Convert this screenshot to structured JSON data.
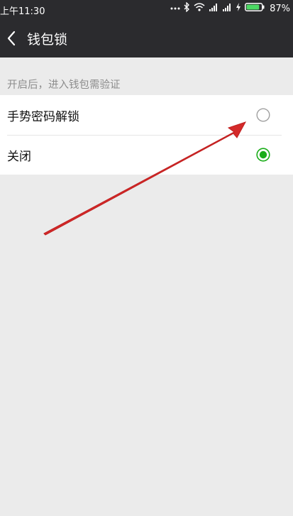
{
  "status_bar": {
    "time": "上午11:30",
    "battery_percent": "87%",
    "battery_level": 0.87,
    "icons": [
      "more-dots-icon",
      "bluetooth-icon",
      "wifi-icon",
      "signal-icon",
      "signal-icon",
      "charging-icon",
      "battery-icon"
    ]
  },
  "nav": {
    "title": "钱包锁",
    "back_icon": "chevron-left-icon"
  },
  "section": {
    "hint": "开启后，进入钱包需验证"
  },
  "options": [
    {
      "label": "手势密码解锁",
      "selected": false
    },
    {
      "label": "关闭",
      "selected": true
    }
  ],
  "colors": {
    "header_bg": "#2b2b2e",
    "page_bg": "#ebebeb",
    "radio_selected": "#1aad19",
    "battery_fill": "#4cd964",
    "annotation_arrow": "#d42a2a"
  }
}
